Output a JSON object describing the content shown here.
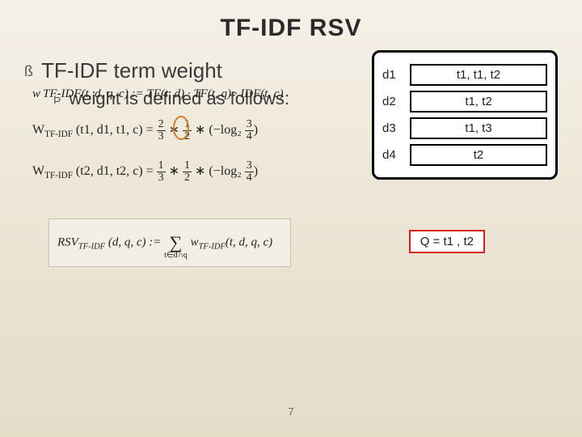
{
  "title": "TF-IDF RSV",
  "main_bullet": "TF-IDF term weight",
  "sub_bullet": "weight is defined as follows:",
  "formula_def": "w TF-IDF(t, d, q, c) := TF(t, d) · TF(t, q) · IDF(t, c)",
  "formula_w1": {
    "lhs": "W",
    "sub": "TF-IDF",
    "args": "(t1, d1, t1, c) =",
    "f1n": "2",
    "f1d": "3",
    "f2n": "1",
    "f2d": "2",
    "log": "(−log₂",
    "f3n": "3",
    "f3d": "4",
    "end": ")"
  },
  "formula_w2": {
    "lhs": "W",
    "sub": "TF-IDF",
    "args": "(t2, d1, t2, c) =",
    "f1n": "1",
    "f1d": "3",
    "f2n": "1",
    "f2d": "2",
    "log": "(−log₂",
    "f3n": "3",
    "f3d": "4",
    "end": ")"
  },
  "rsv": {
    "lhs": "RSV",
    "sub": "TF-IDF",
    "args": "(d, q, c) :=",
    "sum_bot": "t∈d∩q",
    "rhs": "w",
    "rhs_sub": "TF-IDF",
    "rhs_args": "(t, d, q, c)"
  },
  "docs": [
    {
      "label": "d1",
      "content": "t1, t1, t2"
    },
    {
      "label": "d2",
      "content": "t1, t2"
    },
    {
      "label": "d3",
      "content": "t1, t3"
    },
    {
      "label": "d4",
      "content": "t2"
    }
  ],
  "query": "Q = t1 , t2",
  "page_number": "7"
}
